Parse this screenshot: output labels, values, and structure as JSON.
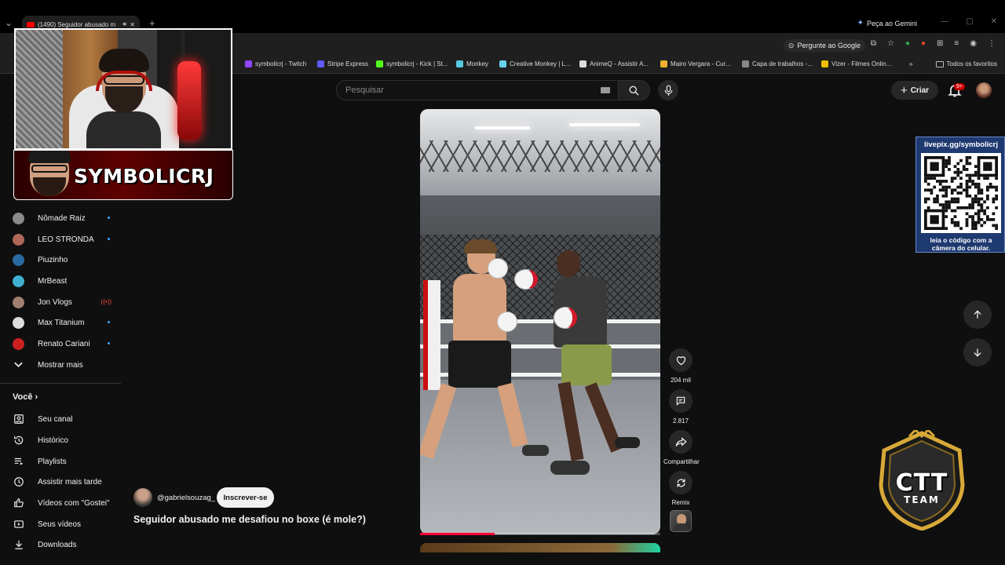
{
  "browser": {
    "tab_title": "(1490) Seguidor abusado m",
    "gemini_label": "Peça ao Gemini",
    "omnibox_action": "Pergunte ao Google",
    "all_bookmarks": "Todos os favoritos",
    "bookmarks": [
      {
        "label": "symbolicrj - Twitch",
        "color": "#9146ff"
      },
      {
        "label": "Stripe Express",
        "color": "#635bff"
      },
      {
        "label": "symbolicrj - Kick | St...",
        "color": "#53fc18"
      },
      {
        "label": "Monkey",
        "color": "#56c8e0"
      },
      {
        "label": "Creative Monkey | L...",
        "color": "#6ad0f0"
      },
      {
        "label": "AnimeQ - Assistir A...",
        "color": "#dddddd"
      },
      {
        "label": "Mairo Vergara - Cur...",
        "color": "#f0b030"
      },
      {
        "label": "Capa de trabalhos -...",
        "color": "#888888"
      },
      {
        "label": "Vizer - Filmes Onlin...",
        "color": "#f0c000"
      }
    ]
  },
  "header": {
    "search_placeholder": "Pesquisar",
    "create_label": "Criar",
    "notifications_badge": "9+"
  },
  "overlay": {
    "streamer_name": "SYMBOLICRJ",
    "qr_title": "livepix.gg/symbolicrj",
    "qr_caption_1": "leia o código com a",
    "qr_caption_2": "câmera do celular.",
    "team_logo_1": "CTT",
    "team_logo_2": "TEAM"
  },
  "sidebar": {
    "subscriptions": [
      {
        "label": "Nômade Raiz",
        "status": "new",
        "avatar_color": "#8a8a8a"
      },
      {
        "label": "LEO STRONDA",
        "status": "new",
        "avatar_color": "#b0685a"
      },
      {
        "label": "Piuzinho",
        "status": "none",
        "avatar_color": "#2a6aa0"
      },
      {
        "label": "MrBeast",
        "status": "none",
        "avatar_color": "#40b0d0"
      },
      {
        "label": "Jon Vlogs",
        "status": "live",
        "avatar_color": "#a08070"
      },
      {
        "label": "Max Titanium",
        "status": "new",
        "avatar_color": "#dddddd"
      },
      {
        "label": "Renato Cariani",
        "status": "new",
        "avatar_color": "#cc2020"
      }
    ],
    "show_more": "Mostrar mais",
    "you_heading": "Você",
    "you_items": [
      {
        "label": "Seu canal",
        "icon": "channel-icon"
      },
      {
        "label": "Histórico",
        "icon": "history-icon"
      },
      {
        "label": "Playlists",
        "icon": "playlists-icon"
      },
      {
        "label": "Assistir mais tarde",
        "icon": "watch-later-icon"
      },
      {
        "label": "Vídeos com \"Gostei\"",
        "icon": "thumbs-up-icon"
      },
      {
        "label": "Seus vídeos",
        "icon": "your-videos-icon"
      },
      {
        "label": "Downloads",
        "icon": "download-icon"
      }
    ]
  },
  "short": {
    "channel_handle": "@gabrielsouzag_",
    "subscribe_label": "Inscrever-se",
    "title": "Seguidor abusado me desafiou no boxe (é mole?)",
    "likes": "204 mil",
    "comments": "2.817",
    "share_label": "Compartilhar",
    "remix_label": "Remix",
    "progress": 0.31
  }
}
